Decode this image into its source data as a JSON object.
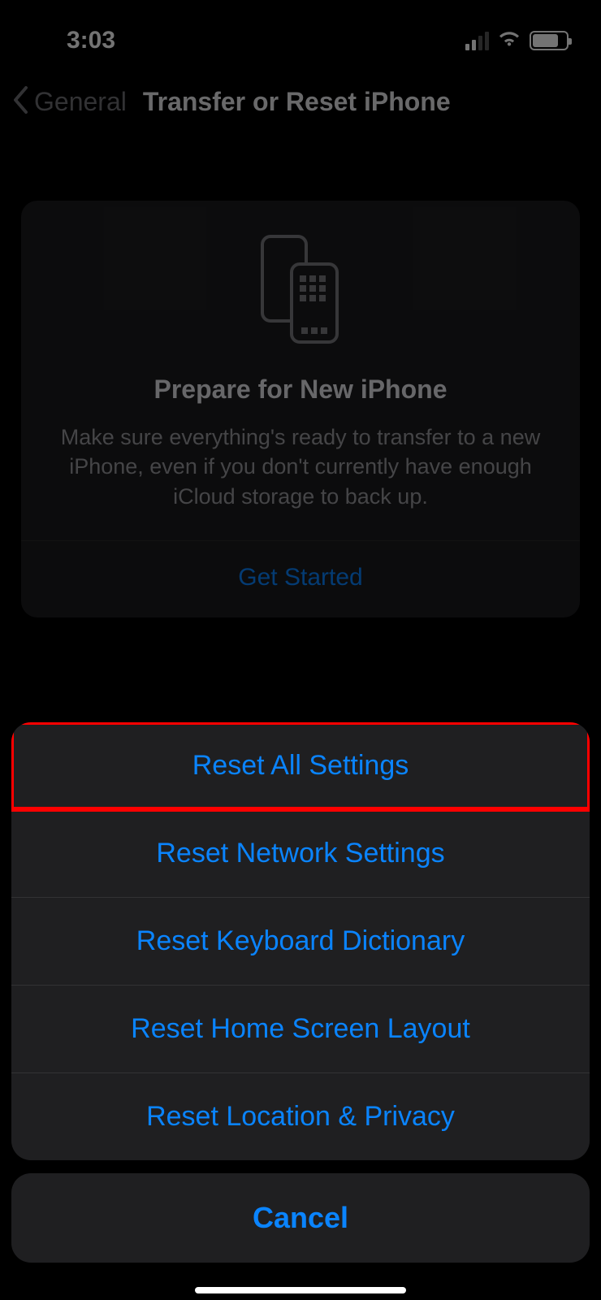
{
  "status": {
    "time": "3:03"
  },
  "nav": {
    "back_label": "General",
    "title": "Transfer or Reset iPhone"
  },
  "prepare_card": {
    "title": "Prepare for New iPhone",
    "body": "Make sure everything's ready to transfer to a new iPhone, even if you don't currently have enough iCloud storage to back up.",
    "cta": "Get Started"
  },
  "action_sheet": {
    "items": [
      "Reset All Settings",
      "Reset Network Settings",
      "Reset Keyboard Dictionary",
      "Reset Home Screen Layout",
      "Reset Location & Privacy"
    ],
    "cancel": "Cancel"
  },
  "highlight_index": 0
}
